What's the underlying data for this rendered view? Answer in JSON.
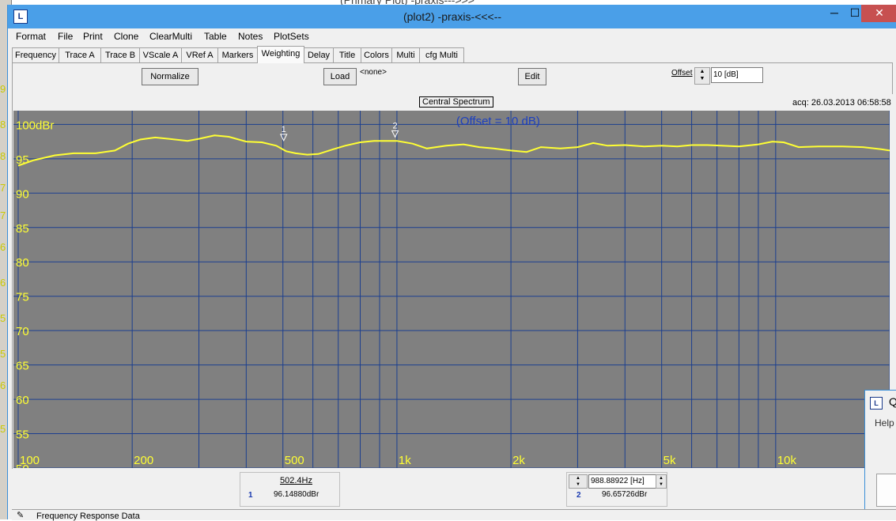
{
  "background_window": {
    "title": "(Primary Plot) -praxis--->>>",
    "left_scale": [
      "9",
      "8",
      "8",
      "7",
      "7",
      "6",
      "6",
      "5",
      "5",
      "6",
      "5"
    ]
  },
  "window": {
    "title": "(plot2) -praxis-<<<--",
    "icon_label": "L",
    "min_label": "─",
    "max_label": "☐",
    "close_label": "✕"
  },
  "menu": [
    "Format",
    "File",
    "Print",
    "Clone",
    "ClearMulti",
    "Table",
    "Notes",
    "PlotSets"
  ],
  "tabs": [
    "Frequency",
    "Trace A",
    "Trace B",
    "VScale A",
    "VRef A",
    "Markers",
    "Weighting",
    "Delay",
    "Title",
    "Colors",
    "Multi",
    "cfg Multi"
  ],
  "active_tab": "Weighting",
  "weighting_panel": {
    "normalize_label": "Normalize",
    "load_label": "Load",
    "file_value": "<none>",
    "edit_label": "Edit",
    "offset_label": "Offset",
    "offset_value": "10 [dB]"
  },
  "chart_header": {
    "title": "Central Spectrum",
    "acq": "acq: 26.03.2013 06:58:58"
  },
  "chart_data": {
    "type": "line",
    "annotation": "(Offset = 10 dB)",
    "xscale": "log",
    "xlim": [
      100,
      20000
    ],
    "ylim": [
      50,
      102
    ],
    "grid": true,
    "x_tick_labels": [
      {
        "value": 100,
        "label": "100"
      },
      {
        "value": 200,
        "label": "200"
      },
      {
        "value": 500,
        "label": "500"
      },
      {
        "value": 1000,
        "label": "1k"
      },
      {
        "value": 2000,
        "label": "2k"
      },
      {
        "value": 5000,
        "label": "5k"
      },
      {
        "value": 10000,
        "label": "10k"
      }
    ],
    "x_gridlines": [
      100,
      200,
      300,
      400,
      500,
      600,
      700,
      800,
      900,
      1000,
      2000,
      3000,
      4000,
      5000,
      6000,
      7000,
      8000,
      9000,
      10000,
      20000
    ],
    "y_ticks": [
      {
        "value": 100,
        "label": "100dBr"
      },
      {
        "value": 95,
        "label": "95"
      },
      {
        "value": 90,
        "label": "90"
      },
      {
        "value": 85,
        "label": "85"
      },
      {
        "value": 80,
        "label": "80"
      },
      {
        "value": 75,
        "label": "75"
      },
      {
        "value": 70,
        "label": "70"
      },
      {
        "value": 65,
        "label": "65"
      },
      {
        "value": 60,
        "label": "60"
      },
      {
        "value": 55,
        "label": "55"
      },
      {
        "value": 50,
        "label": "50"
      }
    ],
    "series": [
      {
        "color": "#ffff33",
        "x": [
          100,
          110,
          125,
          140,
          160,
          180,
          195,
          210,
          230,
          250,
          280,
          300,
          330,
          360,
          400,
          440,
          480,
          510,
          540,
          580,
          620,
          680,
          730,
          800,
          870,
          950,
          1000,
          1100,
          1200,
          1350,
          1500,
          1650,
          1800,
          2000,
          2200,
          2400,
          2700,
          3000,
          3300,
          3600,
          4000,
          4500,
          5000,
          5500,
          6000,
          6600,
          7200,
          8000,
          9000,
          9800,
          10500,
          11500,
          13000,
          15000,
          17000,
          19000,
          20000
        ],
        "y": [
          94.0,
          94.8,
          95.5,
          95.8,
          95.8,
          96.2,
          97.2,
          97.8,
          98.1,
          97.9,
          97.6,
          97.9,
          98.4,
          98.2,
          97.5,
          97.4,
          96.9,
          96.1,
          95.8,
          95.6,
          95.7,
          96.4,
          96.9,
          97.4,
          97.6,
          97.6,
          97.6,
          97.2,
          96.5,
          96.9,
          97.1,
          96.7,
          96.5,
          96.2,
          96.0,
          96.7,
          96.5,
          96.7,
          97.3,
          96.9,
          97.0,
          96.8,
          96.9,
          96.8,
          97.0,
          97.0,
          96.9,
          96.8,
          97.1,
          97.5,
          97.4,
          96.7,
          96.8,
          96.8,
          96.7,
          96.4,
          96.2
        ]
      }
    ],
    "markers": [
      {
        "label": "1",
        "x": 502.4,
        "y": 96.1488
      },
      {
        "label": "2",
        "x": 988.88922,
        "y": 96.65726
      }
    ]
  },
  "readouts": {
    "marker1": {
      "freq": "502.4Hz",
      "index": "1",
      "value": "96.14880dBr"
    },
    "marker2": {
      "freq": "988.88922 [Hz]",
      "index": "2",
      "value": "96.65726dBr"
    }
  },
  "status": {
    "text": "Frequency Response Data"
  },
  "side_window": {
    "title": "Q",
    "menu": "Help"
  }
}
